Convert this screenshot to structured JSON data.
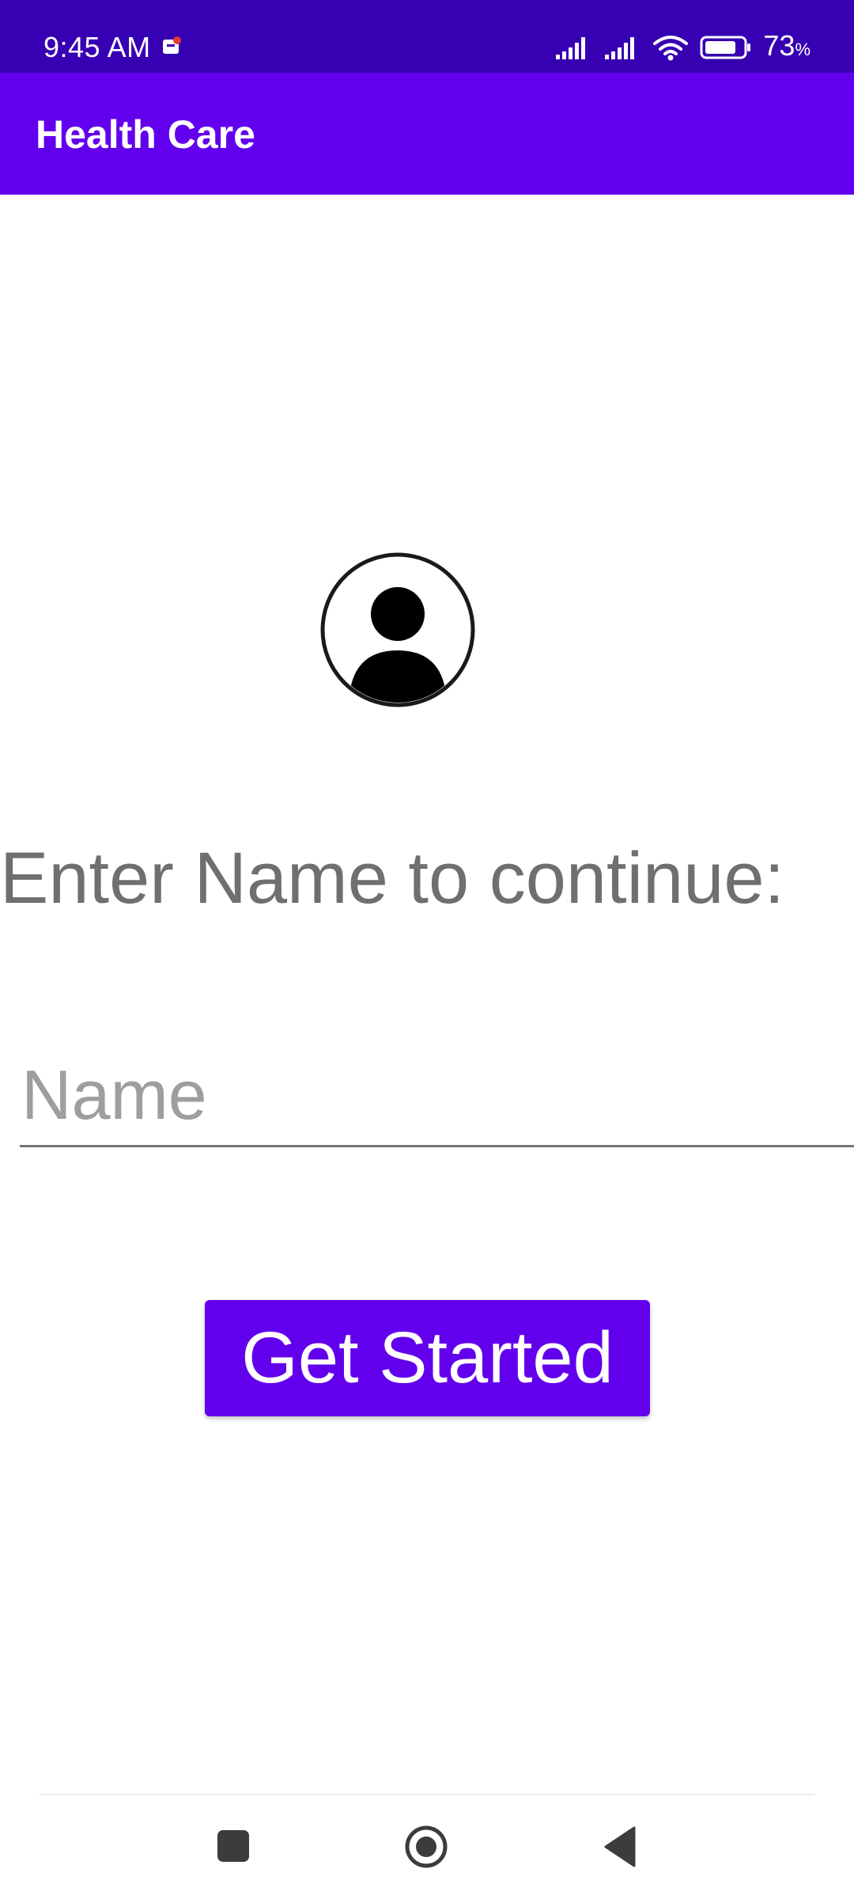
{
  "status_bar": {
    "time": "9:45 AM",
    "battery_percent": "73",
    "battery_unit": "%",
    "icons": [
      "notification-icon",
      "signal-icon",
      "signal-icon",
      "wifi-icon",
      "battery-icon"
    ]
  },
  "app_bar": {
    "title": "Health Care"
  },
  "main": {
    "avatar_icon": "person-avatar-icon",
    "prompt": "Enter Name to continue:",
    "name_input": {
      "value": "",
      "placeholder": "Name"
    },
    "get_started_label": "Get Started"
  },
  "nav_bar": {
    "icons": [
      "recents-square-icon",
      "home-circle-icon",
      "back-triangle-icon"
    ]
  },
  "colors": {
    "status_bar": "#3700b3",
    "primary": "#6200ee",
    "prompt_text": "#6f6f6f",
    "placeholder": "#9e9e9e"
  }
}
